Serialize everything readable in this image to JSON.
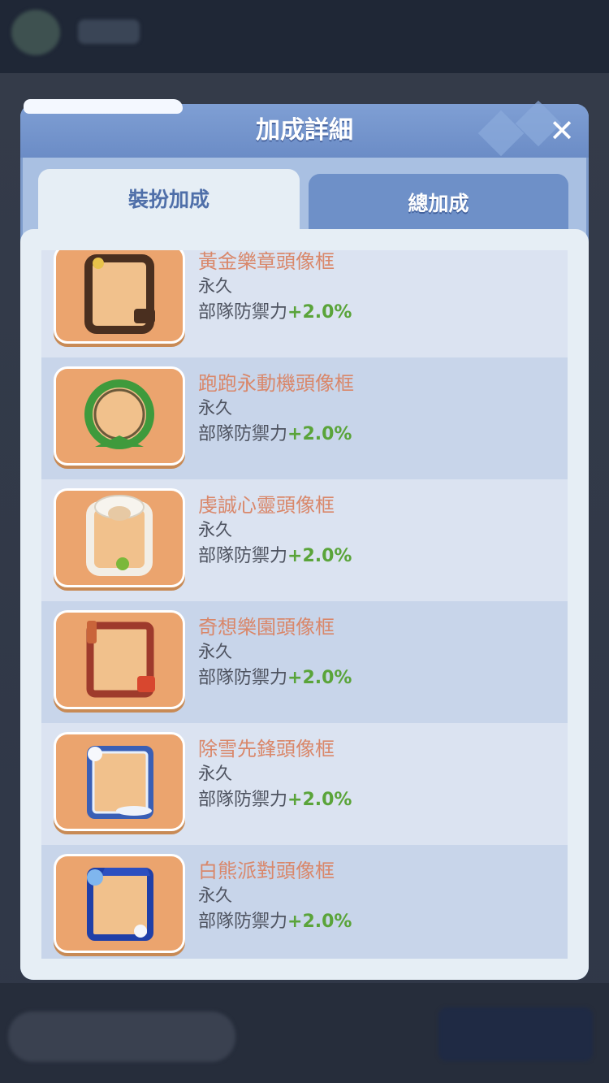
{
  "dialog": {
    "title": "加成詳細",
    "close_icon": "close-icon"
  },
  "tabs": [
    {
      "label": "裝扮加成",
      "active": true
    },
    {
      "label": "總加成",
      "active": false
    }
  ],
  "items": [
    {
      "name": "黃金樂章頭像框",
      "duration": "永久",
      "stat_label": "部隊防禦力",
      "stat_value": "+2.0%",
      "icon": "golden-music-frame-icon",
      "frame_color": "#4a2f1f"
    },
    {
      "name": "跑跑永動機頭像框",
      "duration": "永久",
      "stat_label": "部隊防禦力",
      "stat_value": "+2.0%",
      "icon": "hamster-wheel-frame-icon",
      "frame_color": "#3f9a3c"
    },
    {
      "name": "虔誠心靈頭像框",
      "duration": "永久",
      "stat_label": "部隊防禦力",
      "stat_value": "+2.0%",
      "icon": "sheep-frame-icon",
      "frame_color": "#f2eee6"
    },
    {
      "name": "奇想樂園頭像框",
      "duration": "永久",
      "stat_label": "部隊防禦力",
      "stat_value": "+2.0%",
      "icon": "amusement-park-frame-icon",
      "frame_color": "#9e3a2c"
    },
    {
      "name": "除雪先鋒頭像框",
      "duration": "永久",
      "stat_label": "部隊防禦力",
      "stat_value": "+2.0%",
      "icon": "snow-plow-frame-icon",
      "frame_color": "#3a5fb5"
    },
    {
      "name": "白熊派對頭像框",
      "duration": "永久",
      "stat_label": "部隊防禦力",
      "stat_value": "+2.0%",
      "icon": "polar-bear-party-frame-icon",
      "frame_color": "#1f3fa8"
    }
  ]
}
